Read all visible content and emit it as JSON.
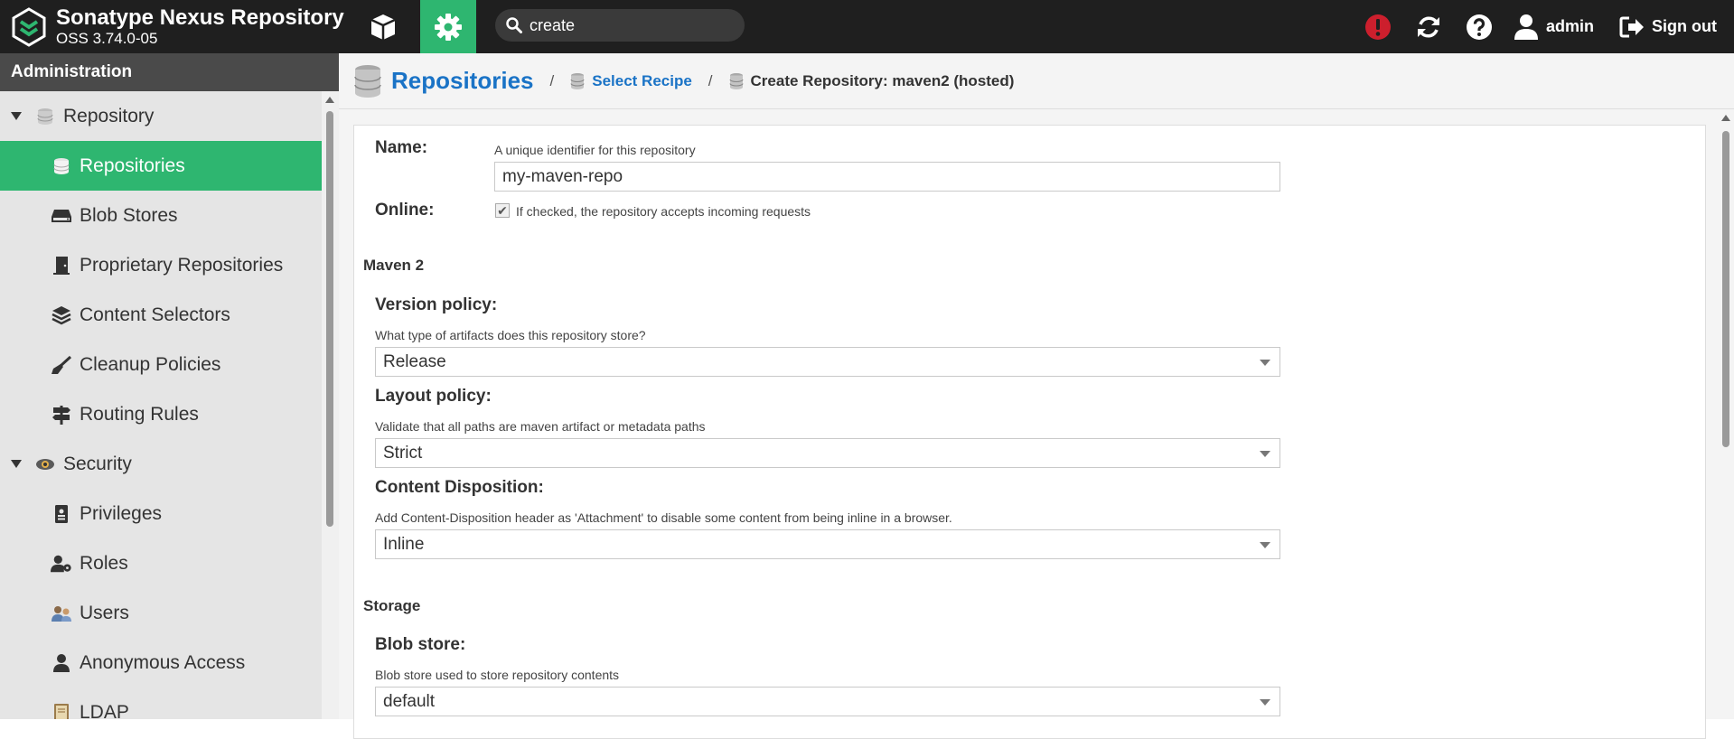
{
  "topbar": {
    "brand_title": "Sonatype Nexus Repository",
    "brand_version": "OSS 3.74.0-05",
    "search_value": "create",
    "user_label": "admin",
    "signout_label": "Sign out",
    "accent_color": "#2eb670",
    "alert_color": "#cc1f2d"
  },
  "sidebar": {
    "header": "Administration",
    "items": [
      {
        "label": "Repository",
        "icon": "database-icon",
        "kind": "group"
      },
      {
        "label": "Repositories",
        "icon": "database-icon",
        "kind": "child",
        "active": true
      },
      {
        "label": "Blob Stores",
        "icon": "hard-drive-icon",
        "kind": "child"
      },
      {
        "label": "Proprietary Repositories",
        "icon": "door-icon",
        "kind": "child"
      },
      {
        "label": "Content Selectors",
        "icon": "layers-icon",
        "kind": "child"
      },
      {
        "label": "Cleanup Policies",
        "icon": "broom-icon",
        "kind": "child"
      },
      {
        "label": "Routing Rules",
        "icon": "signpost-icon",
        "kind": "child"
      },
      {
        "label": "Security",
        "icon": "eye-icon",
        "kind": "group"
      },
      {
        "label": "Privileges",
        "icon": "id-badge-icon",
        "kind": "child"
      },
      {
        "label": "Roles",
        "icon": "user-gear-icon",
        "kind": "child"
      },
      {
        "label": "Users",
        "icon": "users-icon",
        "kind": "child"
      },
      {
        "label": "Anonymous Access",
        "icon": "user-icon",
        "kind": "child"
      },
      {
        "label": "LDAP",
        "icon": "book-icon",
        "kind": "child"
      }
    ]
  },
  "breadcrumb": {
    "title": "Repositories",
    "sep1": "/",
    "link": "Select Recipe",
    "sep2": "/",
    "current": "Create Repository: maven2 (hosted)"
  },
  "form": {
    "name_label": "Name:",
    "name_help": "A unique identifier for this repository",
    "name_value": "my-maven-repo",
    "online_label": "Online:",
    "online_help": "If checked, the repository accepts incoming requests",
    "online_checked": true,
    "maven_section": "Maven 2",
    "version_label": "Version policy:",
    "version_help": "What type of artifacts does this repository store?",
    "version_value": "Release",
    "layout_label": "Layout policy:",
    "layout_help": "Validate that all paths are maven artifact or metadata paths",
    "layout_value": "Strict",
    "disposition_label": "Content Disposition:",
    "disposition_help": "Add Content-Disposition header as 'Attachment' to disable some content from being inline in a browser.",
    "disposition_value": "Inline",
    "storage_section": "Storage",
    "blob_label": "Blob store:",
    "blob_help": "Blob store used to store repository contents",
    "blob_value": "default"
  }
}
